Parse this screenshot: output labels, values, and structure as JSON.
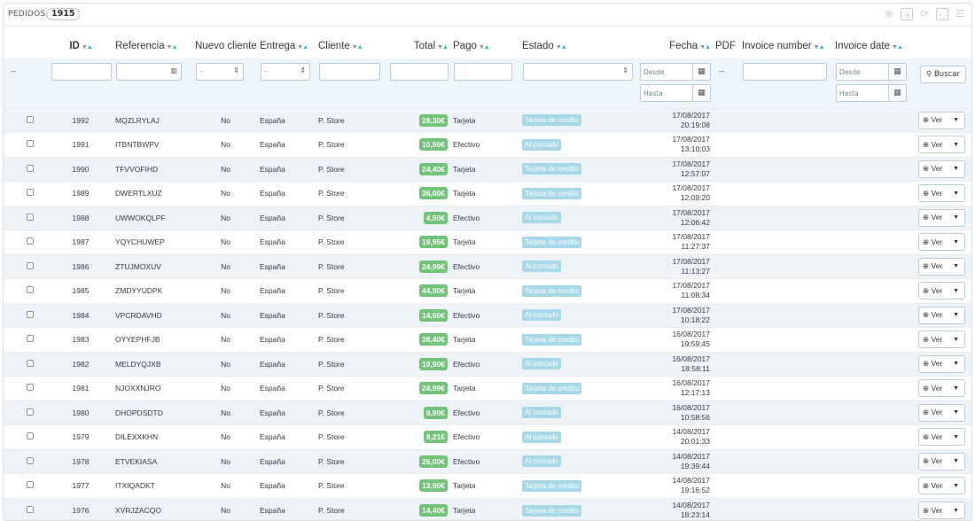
{
  "header": {
    "title": "PEDIDOS",
    "count": "1915"
  },
  "toolbar": {
    "icons": [
      "add-icon",
      "export-icon",
      "refresh-icon",
      "sql-icon",
      "database-icon"
    ]
  },
  "columns": {
    "id": "ID",
    "referencia": "Referencia",
    "nuevo_cliente": "Nuevo cliente",
    "entrega": "Entrega",
    "cliente": "Cliente",
    "total": "Total",
    "pago": "Pago",
    "estado": "Estado",
    "fecha": "Fecha",
    "pdf": "PDF",
    "invoice_number": "Invoice number",
    "invoice_date": "Invoice date"
  },
  "filters": {
    "dash": "--",
    "select_dash": "-",
    "desde": "Desde",
    "hasta": "Hasta",
    "buscar": "Buscar"
  },
  "row_action": {
    "label": "Ver"
  },
  "orders": [
    {
      "id": "1992",
      "ref": "MQZLRYLAJ",
      "new": "No",
      "country": "España",
      "customer": "P. Store",
      "total": "28,30€",
      "payment": "Tarjeta",
      "status": "Tarjeta de credito",
      "date": "17/08/2017",
      "time": "20:19:08"
    },
    {
      "id": "1991",
      "ref": "ITBNTBWPV",
      "new": "No",
      "country": "España",
      "customer": "P. Store",
      "total": "10,90€",
      "payment": "Efectivo",
      "status": "Al contado",
      "date": "17/08/2017",
      "time": "13:10:03"
    },
    {
      "id": "1990",
      "ref": "TFVVOFIHD",
      "new": "No",
      "country": "España",
      "customer": "P. Store",
      "total": "24,40€",
      "payment": "Tarjeta",
      "status": "Tarjeta de credito",
      "date": "17/08/2017",
      "time": "12:57:07"
    },
    {
      "id": "1989",
      "ref": "DWERTLXUZ",
      "new": "No",
      "country": "España",
      "customer": "P. Store",
      "total": "36,00€",
      "payment": "Tarjeta",
      "status": "Tarjeta de credito",
      "date": "17/08/2017",
      "time": "12:09:20"
    },
    {
      "id": "1988",
      "ref": "UWWOKQLPF",
      "new": "No",
      "country": "España",
      "customer": "P. Store",
      "total": "4,50€",
      "payment": "Efectivo",
      "status": "Al contado",
      "date": "17/08/2017",
      "time": "12:06:42"
    },
    {
      "id": "1987",
      "ref": "YQYCHUWEP",
      "new": "No",
      "country": "España",
      "customer": "P. Store",
      "total": "19,95€",
      "payment": "Tarjeta",
      "status": "Tarjeta de credito",
      "date": "17/08/2017",
      "time": "11:27:37"
    },
    {
      "id": "1986",
      "ref": "ZTUJMOXUV",
      "new": "No",
      "country": "España",
      "customer": "P. Store",
      "total": "24,99€",
      "payment": "Efectivo",
      "status": "Al contado",
      "date": "17/08/2017",
      "time": "11:13:27"
    },
    {
      "id": "1985",
      "ref": "ZMDYYUDPK",
      "new": "No",
      "country": "España",
      "customer": "P. Store",
      "total": "44,90€",
      "payment": "Tarjeta",
      "status": "Tarjeta de credito",
      "date": "17/08/2017",
      "time": "11:08:34"
    },
    {
      "id": "1984",
      "ref": "VPCRDAVHD",
      "new": "No",
      "country": "España",
      "customer": "P. Store",
      "total": "14,90€",
      "payment": "Efectivo",
      "status": "Al contado",
      "date": "17/08/2017",
      "time": "10:18:22"
    },
    {
      "id": "1983",
      "ref": "OYYEPHFJB",
      "new": "No",
      "country": "España",
      "customer": "P. Store",
      "total": "38,40€",
      "payment": "Tarjeta",
      "status": "Tarjeta de credito",
      "date": "16/08/2017",
      "time": "19:59:45"
    },
    {
      "id": "1982",
      "ref": "MELDYQJXB",
      "new": "No",
      "country": "España",
      "customer": "P. Store",
      "total": "19,90€",
      "payment": "Efectivo",
      "status": "Al contado",
      "date": "16/08/2017",
      "time": "18:58:11"
    },
    {
      "id": "1981",
      "ref": "NJOXXNJRO",
      "new": "No",
      "country": "España",
      "customer": "P. Store",
      "total": "24,99€",
      "payment": "Tarjeta",
      "status": "Tarjeta de credito",
      "date": "16/08/2017",
      "time": "12:17:13"
    },
    {
      "id": "1980",
      "ref": "DHOPDSDTD",
      "new": "No",
      "country": "España",
      "customer": "P. Store",
      "total": "9,90€",
      "payment": "Efectivo",
      "status": "Al contado",
      "date": "16/08/2017",
      "time": "10:58:56"
    },
    {
      "id": "1979",
      "ref": "DILEXXKHN",
      "new": "No",
      "country": "España",
      "customer": "P. Store",
      "total": "9,21€",
      "payment": "Efectivo",
      "status": "Al contado",
      "date": "14/08/2017",
      "time": "20:01:33"
    },
    {
      "id": "1978",
      "ref": "ETVEKIASA",
      "new": "No",
      "country": "España",
      "customer": "P. Store",
      "total": "26,00€",
      "payment": "Efectivo",
      "status": "Al contado",
      "date": "14/08/2017",
      "time": "19:39:44"
    },
    {
      "id": "1977",
      "ref": "ITXIQADKT",
      "new": "No",
      "country": "España",
      "customer": "P. Store",
      "total": "13,90€",
      "payment": "Tarjeta",
      "status": "Tarjeta de credito",
      "date": "14/08/2017",
      "time": "19:16:52"
    },
    {
      "id": "1976",
      "ref": "XVRJZACQO",
      "new": "No",
      "country": "España",
      "customer": "P. Store",
      "total": "14,40€",
      "payment": "Tarjeta",
      "status": "Tarjeta de credito",
      "date": "14/08/2017",
      "time": "18:23:14"
    }
  ]
}
